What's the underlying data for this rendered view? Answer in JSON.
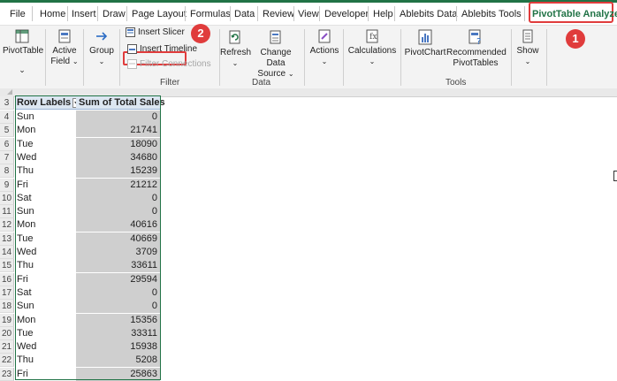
{
  "menu": {
    "tabs": [
      "File",
      "Home",
      "Insert",
      "Draw",
      "Page Layout",
      "Formulas",
      "Data",
      "Review",
      "View",
      "Developer",
      "Help",
      "Ablebits Data",
      "Ablebits Tools"
    ],
    "active_tab": "PivotTable Analyze"
  },
  "ribbon": {
    "pivottable_label": "PivotTable",
    "active_field_label_1": "Active",
    "active_field_label_2": "Field",
    "group_label": "Group",
    "insert_slicer": "Insert Slicer",
    "insert_timeline": "Insert Timeline",
    "filter_connections": "Filter Connections",
    "filter_group": "Filter",
    "refresh": "Refresh",
    "change_source_1": "Change Data",
    "change_source_2": "Source",
    "data_group": "Data",
    "actions": "Actions",
    "calculations": "Calculations",
    "pivotchart": "PivotChart",
    "recommended_1": "Recommended",
    "recommended_2": "PivotTables",
    "tools_group": "Tools",
    "show": "Show"
  },
  "badges": {
    "one": "1",
    "two": "2"
  },
  "colors": {
    "accent_green": "#217346",
    "highlight_red": "#e03c3c"
  },
  "sheet": {
    "header_row_number": "3",
    "row_labels": "Row Labels",
    "sum_header": "Sum of Total Sales",
    "rows": [
      {
        "n": "4",
        "day": "Sun",
        "value": "0"
      },
      {
        "n": "5",
        "day": "Mon",
        "value": "21741"
      },
      {
        "n": "6",
        "day": "Tue",
        "value": "18090"
      },
      {
        "n": "7",
        "day": "Wed",
        "value": "34680"
      },
      {
        "n": "8",
        "day": "Thu",
        "value": "15239"
      },
      {
        "n": "9",
        "day": "Fri",
        "value": "21212"
      },
      {
        "n": "10",
        "day": "Sat",
        "value": "0"
      },
      {
        "n": "11",
        "day": "Sun",
        "value": "0"
      },
      {
        "n": "12",
        "day": "Mon",
        "value": "40616"
      },
      {
        "n": "13",
        "day": "Tue",
        "value": "40669"
      },
      {
        "n": "14",
        "day": "Wed",
        "value": "3709"
      },
      {
        "n": "15",
        "day": "Thu",
        "value": "33611"
      },
      {
        "n": "16",
        "day": "Fri",
        "value": "29594"
      },
      {
        "n": "17",
        "day": "Sat",
        "value": "0"
      },
      {
        "n": "18",
        "day": "Sun",
        "value": "0"
      },
      {
        "n": "19",
        "day": "Mon",
        "value": "15356"
      },
      {
        "n": "20",
        "day": "Tue",
        "value": "33311"
      },
      {
        "n": "21",
        "day": "Wed",
        "value": "15938"
      },
      {
        "n": "22",
        "day": "Thu",
        "value": "5208"
      },
      {
        "n": "23",
        "day": "Fri",
        "value": "25863"
      }
    ]
  }
}
